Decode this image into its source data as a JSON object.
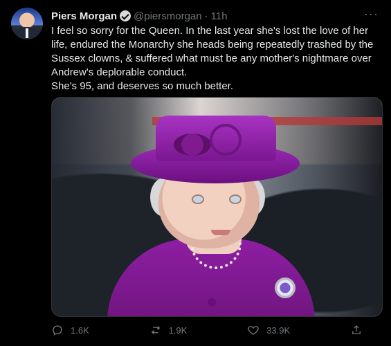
{
  "tweet": {
    "display_name": "Piers Morgan",
    "handle": "@piersmorgan",
    "separator": "·",
    "time": "11h",
    "text": "I feel so sorry for the Queen. In the last year she's lost the love of her life, endured the Monarchy she heads being repeatedly trashed by the Sussex clowns, & suffered what must be any mother's nightmare over Andrew's deplorable conduct.\nShe's 95, and deserves so much better.",
    "more_label": "···",
    "actions": {
      "reply_count": "1.6K",
      "retweet_count": "1.9K",
      "like_count": "33.9K"
    }
  },
  "colors": {
    "background": "#000000",
    "text": "#e7e9ea",
    "muted": "#71767b"
  },
  "icons": {
    "verified": "verified-badge-icon",
    "reply": "reply-icon",
    "retweet": "retweet-icon",
    "like": "heart-icon",
    "share": "share-icon"
  }
}
